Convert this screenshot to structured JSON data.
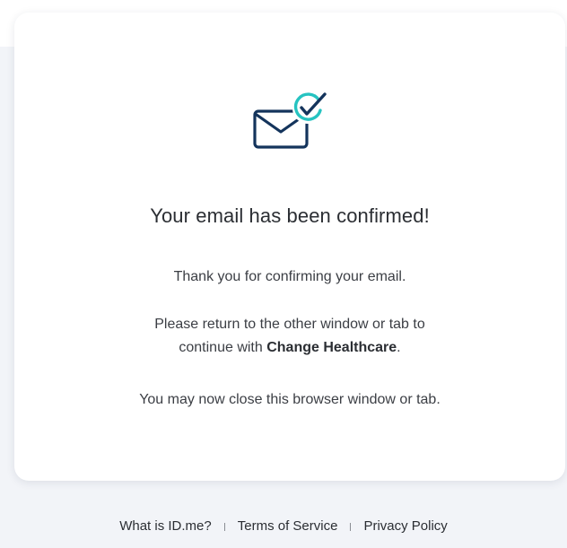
{
  "card": {
    "icon": "email-confirmed-icon",
    "headline": "Your email has been confirmed!",
    "message_1": "Thank you for confirming your email.",
    "message_2_prefix": "Please return to the other window or tab to",
    "message_2_line2_prefix": "continue with ",
    "message_2_brand": "Change Healthcare",
    "message_2_suffix": ".",
    "message_3": "You may now close this browser window or tab."
  },
  "footer": {
    "links": [
      {
        "label": "What is ID.me?"
      },
      {
        "label": "Terms of Service"
      },
      {
        "label": "Privacy Policy"
      }
    ]
  },
  "colors": {
    "page_background": "#f2f4f8",
    "card_background": "#ffffff",
    "envelope_stroke": "#14345c",
    "check_circle": "#26c3c1",
    "text": "#2b2e33"
  }
}
